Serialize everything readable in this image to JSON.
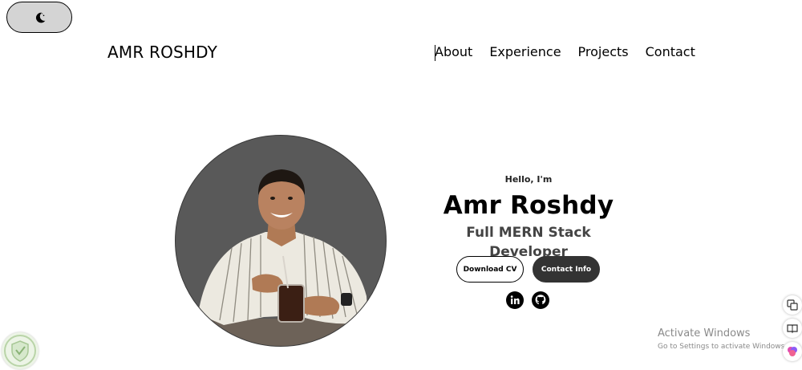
{
  "theme_toggle": {
    "icon": "moon-icon"
  },
  "header": {
    "brand": "AMR ROSHDY",
    "nav": [
      {
        "label": "About"
      },
      {
        "label": "Experience"
      },
      {
        "label": "Projects"
      },
      {
        "label": "Contact"
      }
    ]
  },
  "profile": {
    "greeting": "Hello, I'm",
    "name": "Amr Roshdy",
    "title": "Full MERN Stack Developer",
    "buttons": {
      "download_cv": "Download CV",
      "contact_info": "Contact Info"
    },
    "socials": [
      {
        "icon": "linkedin-icon"
      },
      {
        "icon": "github-icon"
      }
    ]
  },
  "watermark": {
    "line1": "Activate Windows",
    "line2": "Go to Settings to activate Windows."
  },
  "colors": {
    "toggle_bg": "#d4d4d4",
    "avatar_bg": "#595959",
    "dark_button": "#333333",
    "watermark_text": "#8a8a8a"
  }
}
